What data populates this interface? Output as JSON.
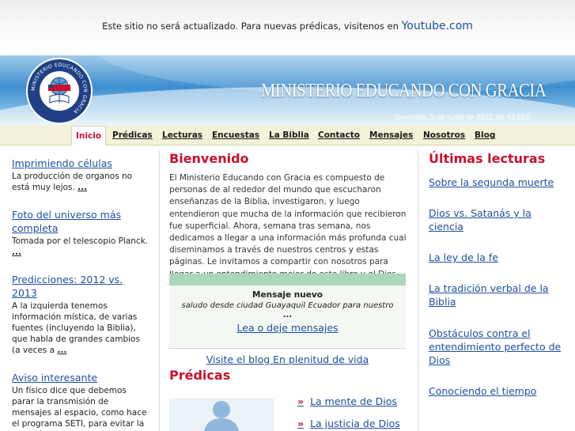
{
  "notice": {
    "text": "Este sitio no será actualizado. Para nuevas prédicas, visitenos en",
    "link": "Youtube.com"
  },
  "header": {
    "title": "MINISTERIO EDUCANDO CON GRACIA",
    "date": "Domingo, 5 de Junio de 2011 08:43 EST",
    "logo_text": "MINISTERIO EDUCANDO CON GRACIA"
  },
  "nav": {
    "items": [
      "Inicio",
      "Prédicas",
      "Lecturas",
      "Encuestas",
      "La Biblia",
      "Contacto",
      "Mensajes",
      "Nosotros",
      "Blog"
    ],
    "active": "Inicio"
  },
  "left_articles": [
    {
      "title": "Imprimiendo células",
      "text": "La producción de organos no está muy lejos.",
      "more": "..."
    },
    {
      "title": "Foto del universo más completa",
      "text": "Tomada por el telescopio Planck.",
      "more": "..."
    },
    {
      "title": "Predicciones: 2012 vs. 2013",
      "text": "A la izquierda tenemos información mística, de varias fuentes (incluyendo la Biblia), que habla de grandes cambios (a veces a",
      "more": "..."
    },
    {
      "title": "Aviso interesante",
      "text": "Un físico dice que debemos parar la transmisión de mensajes al espacio, como hace el programa SETI, para evitar la atención d",
      "more": ""
    }
  ],
  "welcome": {
    "title": "Bienvenido",
    "text": "El Ministerio Educando con Gracia es compuesto de personas de al rededor del mundo que escucharon enseñanzas de la Biblia, investigaron, y luego entendieron que mucha de la información que recibieron fue superficial. Ahora, semana tras semana, nos dedicamos a llegar a una información más profunda cual diseminamos a través de nuestros centros y estas páginas. Le invitamos a compartir con nosotros para llegar a un entendimiento mejor de este libro y el Dios de quien nos comunica."
  },
  "message_box": {
    "heading": "Mensaje nuevo",
    "text": "saludo desde ciudad Guayaquil Ecuador para nuestro",
    "dots": "...",
    "link": "Lea o deje mensajes"
  },
  "blog_link": "Visite el blog En plenitud de vida",
  "predicas": {
    "title": "Prédicas",
    "items": [
      "La mente de Dios",
      "La justicia de Dios"
    ],
    "arrow": "»"
  },
  "lecturas": {
    "title": "Últimas lecturas",
    "items": [
      "Sobre la segunda muerte",
      "Dios vs. Satanás y la ciencia",
      "La ley de la fe",
      "La tradición verbal de la Biblia",
      "Obstáculos contra el entendimiento perfecto de Dios",
      "Conociendo el tiempo"
    ]
  },
  "colors": {
    "accent_red": "#c8102e",
    "link_blue": "#1f4f9e",
    "nav_bg": "#f4f1d9",
    "header_blue": "#3d8ed0"
  }
}
